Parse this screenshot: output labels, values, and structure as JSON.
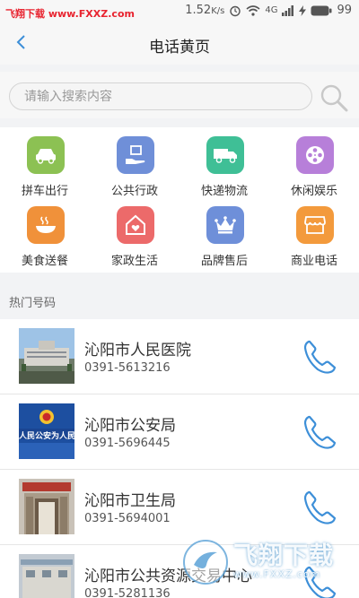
{
  "status_bar": {
    "watermark_text": "飞翔下载 www.FXXZ.com",
    "speed": "1.52",
    "speed_unit": "K/s",
    "network": "4G",
    "battery": "99"
  },
  "header": {
    "title": "电话黄页",
    "back_icon": "chevron-left-icon"
  },
  "search": {
    "placeholder": "请输入搜索内容",
    "value": ""
  },
  "categories": [
    {
      "label": "拼车出行",
      "icon": "car-icon",
      "color": "#8cc153"
    },
    {
      "label": "公共行政",
      "icon": "hand-box-icon",
      "color": "#6f8fd8"
    },
    {
      "label": "快递物流",
      "icon": "truck-icon",
      "color": "#3fbf96"
    },
    {
      "label": "休闲娱乐",
      "icon": "film-reel-icon",
      "color": "#b77fd9"
    },
    {
      "label": "美食送餐",
      "icon": "bowl-icon",
      "color": "#f0913a"
    },
    {
      "label": "家政生活",
      "icon": "house-heart-icon",
      "color": "#ec6a6a"
    },
    {
      "label": "品牌售后",
      "icon": "crown-icon",
      "color": "#6e8fd9"
    },
    {
      "label": "商业电话",
      "icon": "shop-icon",
      "color": "#f39a3c"
    }
  ],
  "section": {
    "title": "热门号码"
  },
  "contacts": [
    {
      "name": "沁阳市人民医院",
      "phone": "0391-5613216"
    },
    {
      "name": "沁阳市公安局",
      "phone": "0391-5696445",
      "thumb_text": "人民公安为人民"
    },
    {
      "name": "沁阳市卫生局",
      "phone": "0391-5694001"
    },
    {
      "name": "沁阳市公共资源交易中心",
      "phone": "0391-5281136"
    }
  ],
  "watermark": {
    "text": "飞翔下载",
    "url": "www.FXXZ.com"
  },
  "colors": {
    "accent": "#3d8fd8",
    "text_primary": "#333333",
    "background": "#f2f3f5"
  }
}
